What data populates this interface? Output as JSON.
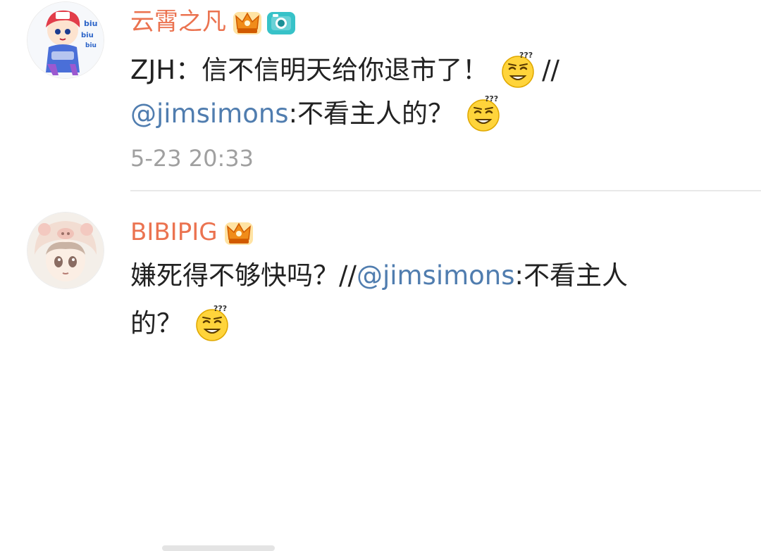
{
  "comments": [
    {
      "user_name": "云霄之凡",
      "badges": [
        "crown-badge-icon",
        "camera-badge-icon"
      ],
      "line1_text": "ZJH：信不信明天给你退市了！",
      "line1_suffix": "//",
      "line2_mention": "@jimsimons",
      "line2_text": ":不看主人的？",
      "emoji": "doubt-smirk-emoji",
      "timestamp": "5-23 20:33"
    },
    {
      "user_name": "BIBIPIG",
      "badges": [
        "crown-badge-icon"
      ],
      "line1_text": "嫌死得不够快吗？//",
      "line1_mention": "@jimsimons",
      "line1_tail": ":不看主人",
      "line2_text": "的？",
      "emoji": "doubt-smirk-emoji"
    }
  ],
  "colors": {
    "name": "#eb7350",
    "mention": "#507daf",
    "text": "#222222",
    "timestamp": "#a0a0a0",
    "divider": "#e8e8e8"
  }
}
